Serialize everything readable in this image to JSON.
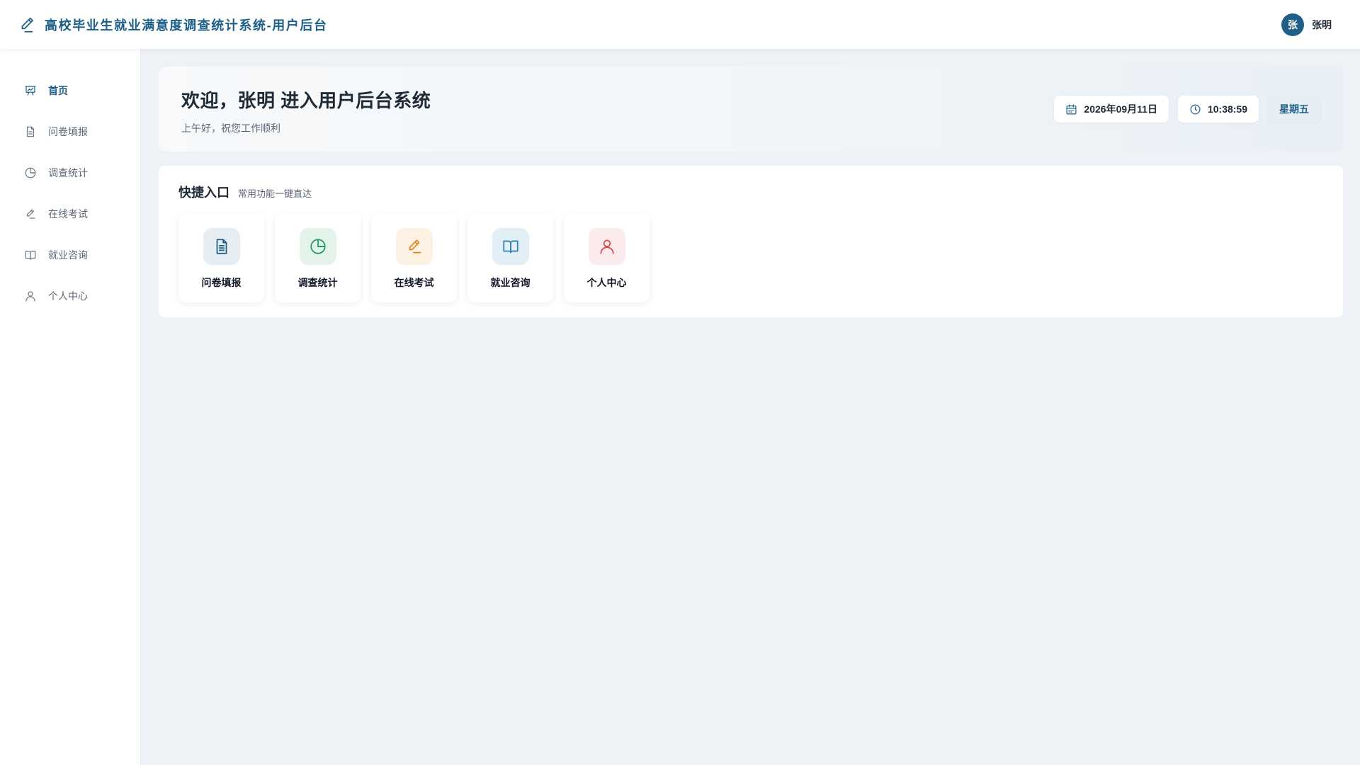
{
  "header": {
    "title": "高校毕业生就业满意度调查统计系统-用户后台",
    "brand_icon": "pen-icon",
    "user": {
      "avatar_text": "张",
      "name": "张明"
    }
  },
  "sidebar": {
    "items": [
      {
        "label": "首页",
        "icon": "presentation-chart-icon",
        "active": true
      },
      {
        "label": "问卷填报",
        "icon": "document-icon",
        "active": false
      },
      {
        "label": "调查统计",
        "icon": "pie-chart-icon",
        "active": false
      },
      {
        "label": "在线考试",
        "icon": "pen-icon",
        "active": false
      },
      {
        "label": "就业咨询",
        "icon": "book-icon",
        "active": false
      },
      {
        "label": "个人中心",
        "icon": "user-icon",
        "active": false
      }
    ]
  },
  "welcome": {
    "title": "欢迎，张明 进入用户后台系统",
    "subtitle": "上午好，祝您工作顺利",
    "date": "2026年09月11日",
    "time": "10:38:59",
    "weekday": "星期五"
  },
  "quick": {
    "title": "快捷入口",
    "subtitle": "常用功能一键直达",
    "tiles": [
      {
        "label": "问卷填报",
        "icon": "document-icon",
        "color": "#1d5f86",
        "bg": "#e6eef4"
      },
      {
        "label": "调查统计",
        "icon": "pie-chart-icon",
        "color": "#1e9a5b",
        "bg": "#e4f3ea"
      },
      {
        "label": "在线考试",
        "icon": "pen-icon",
        "color": "#e08a1e",
        "bg": "#fdf1e3"
      },
      {
        "label": "就业咨询",
        "icon": "book-icon",
        "color": "#2f7fab",
        "bg": "#e3eff6"
      },
      {
        "label": "个人中心",
        "icon": "user-icon",
        "color": "#d9434a",
        "bg": "#fcebec"
      }
    ]
  },
  "colors": {
    "primary": "#1d5f86",
    "background": "#eef2f6"
  }
}
